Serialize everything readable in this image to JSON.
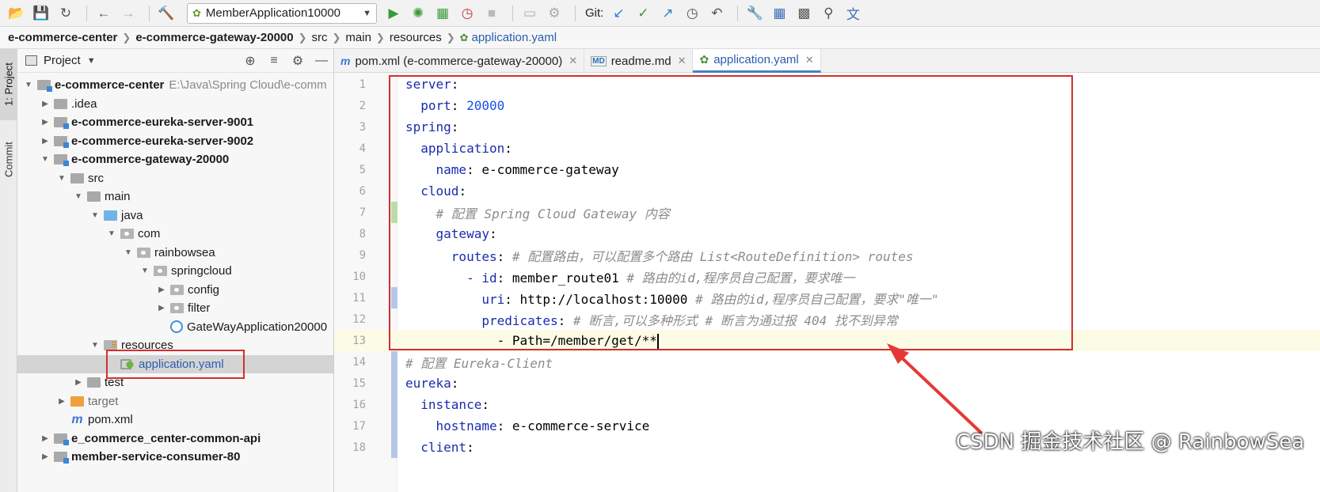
{
  "toolbar": {
    "run_config": "MemberApplication10000",
    "git_label": "Git:"
  },
  "breadcrumb": [
    "e-commerce-center",
    "e-commerce-gateway-20000",
    "src",
    "main",
    "resources",
    "application.yaml"
  ],
  "side_strip": {
    "project_tab": "1: Project",
    "commit_tab": "Commit"
  },
  "project_panel": {
    "title": "Project",
    "tree": [
      {
        "label": "e-commerce-center",
        "path": "E:\\Java\\Spring Cloud\\e-comm",
        "depth": 0,
        "arrow": "open",
        "icon": "module",
        "bold": true
      },
      {
        "label": ".idea",
        "depth": 1,
        "arrow": "closed",
        "icon": "folder"
      },
      {
        "label": "e-commerce-eureka-server-9001",
        "depth": 1,
        "arrow": "closed",
        "icon": "module",
        "bold": true
      },
      {
        "label": "e-commerce-eureka-server-9002",
        "depth": 1,
        "arrow": "closed",
        "icon": "module",
        "bold": true
      },
      {
        "label": "e-commerce-gateway-20000",
        "depth": 1,
        "arrow": "open",
        "icon": "module",
        "bold": true
      },
      {
        "label": "src",
        "depth": 2,
        "arrow": "open",
        "icon": "folder"
      },
      {
        "label": "main",
        "depth": 3,
        "arrow": "open",
        "icon": "folder"
      },
      {
        "label": "java",
        "depth": 4,
        "arrow": "open",
        "icon": "srcf"
      },
      {
        "label": "com",
        "depth": 5,
        "arrow": "open",
        "icon": "pkg"
      },
      {
        "label": "rainbowsea",
        "depth": 6,
        "arrow": "open",
        "icon": "pkg"
      },
      {
        "label": "springcloud",
        "depth": 7,
        "arrow": "open",
        "icon": "pkg"
      },
      {
        "label": "config",
        "depth": 8,
        "arrow": "closed",
        "icon": "pkg"
      },
      {
        "label": "filter",
        "depth": 8,
        "arrow": "closed",
        "icon": "pkg"
      },
      {
        "label": "GateWayApplication20000",
        "depth": 8,
        "arrow": "none",
        "icon": "springapp"
      },
      {
        "label": "resources",
        "depth": 4,
        "arrow": "open",
        "icon": "res"
      },
      {
        "label": "application.yaml",
        "depth": 5,
        "arrow": "none",
        "icon": "yaml",
        "selected": true
      },
      {
        "label": "test",
        "depth": 3,
        "arrow": "closed",
        "icon": "folder"
      },
      {
        "label": "target",
        "depth": 2,
        "arrow": "closed",
        "icon": "target",
        "dim": true
      },
      {
        "label": "pom.xml",
        "depth": 2,
        "arrow": "none",
        "icon": "pom"
      },
      {
        "label": "e_commerce_center-common-api",
        "depth": 1,
        "arrow": "closed",
        "icon": "module",
        "bold": true
      },
      {
        "label": "member-service-consumer-80",
        "depth": 1,
        "arrow": "closed",
        "icon": "module",
        "bold": true
      }
    ]
  },
  "tabs": [
    {
      "label": "pom.xml (e-commerce-gateway-20000)",
      "icon": "m",
      "active": false
    },
    {
      "label": "readme.md",
      "icon": "md",
      "active": false
    },
    {
      "label": "application.yaml",
      "icon": "y",
      "active": true
    }
  ],
  "editor": {
    "current_line": 13,
    "lines": [
      {
        "n": "1",
        "indent": "",
        "key": "server",
        "sep": ":",
        "val": "",
        "num": "",
        "comment": ""
      },
      {
        "n": "2",
        "indent": "  ",
        "key": "port",
        "sep": ": ",
        "val": "",
        "num": "20000",
        "comment": ""
      },
      {
        "n": "3",
        "indent": "",
        "key": "spring",
        "sep": ":",
        "val": "",
        "num": "",
        "comment": ""
      },
      {
        "n": "4",
        "indent": "  ",
        "key": "application",
        "sep": ":",
        "val": "",
        "num": "",
        "comment": ""
      },
      {
        "n": "5",
        "indent": "    ",
        "key": "name",
        "sep": ": ",
        "val": "e-commerce-gateway",
        "num": "",
        "comment": ""
      },
      {
        "n": "6",
        "indent": "  ",
        "key": "cloud",
        "sep": ":",
        "val": "",
        "num": "",
        "comment": ""
      },
      {
        "n": "7",
        "indent": "    ",
        "key": "",
        "sep": "",
        "val": "",
        "num": "",
        "comment": "# 配置 Spring Cloud Gateway 内容"
      },
      {
        "n": "8",
        "indent": "    ",
        "key": "gateway",
        "sep": ":",
        "val": "",
        "num": "",
        "comment": ""
      },
      {
        "n": "9",
        "indent": "      ",
        "key": "routes",
        "sep": ": ",
        "val": "",
        "num": "",
        "comment": "# 配置路由，可以配置多个路由 List<RouteDefinition> routes"
      },
      {
        "n": "10",
        "indent": "        ",
        "key": "- id",
        "sep": ": ",
        "val": "member_route01 ",
        "num": "",
        "comment": "# 路由的id,程序员自己配置，要求唯一"
      },
      {
        "n": "11",
        "indent": "          ",
        "key": "uri",
        "sep": ": ",
        "val": "http://localhost:10000 ",
        "num": "",
        "comment": "# 路由的id,程序员自己配置，要求\"唯一\""
      },
      {
        "n": "12",
        "indent": "          ",
        "key": "predicates",
        "sep": ": ",
        "val": "",
        "num": "",
        "comment": "# 断言,可以多种形式 # 断言为通过报 404 找不到异常"
      },
      {
        "n": "13",
        "indent": "            ",
        "key": "",
        "sep": "",
        "val": "- Path=/member/get/**",
        "num": "",
        "comment": ""
      },
      {
        "n": "14",
        "indent": "",
        "key": "",
        "sep": "",
        "val": "",
        "num": "",
        "comment": "# 配置 Eureka-Client"
      },
      {
        "n": "15",
        "indent": "",
        "key": "eureka",
        "sep": ":",
        "val": "",
        "num": "",
        "comment": ""
      },
      {
        "n": "16",
        "indent": "  ",
        "key": "instance",
        "sep": ":",
        "val": "",
        "num": "",
        "comment": ""
      },
      {
        "n": "17",
        "indent": "    ",
        "key": "hostname",
        "sep": ": ",
        "val": "e-commerce-service",
        "num": "",
        "comment": ""
      },
      {
        "n": "18",
        "indent": "  ",
        "key": "client",
        "sep": ":",
        "val": "",
        "num": "",
        "comment": ""
      }
    ]
  },
  "watermark": "CSDN 掘金技术社区 @ RainbowSea",
  "colors": {
    "annotation_red": "#d32f2f",
    "accent_blue": "#4083c9"
  }
}
